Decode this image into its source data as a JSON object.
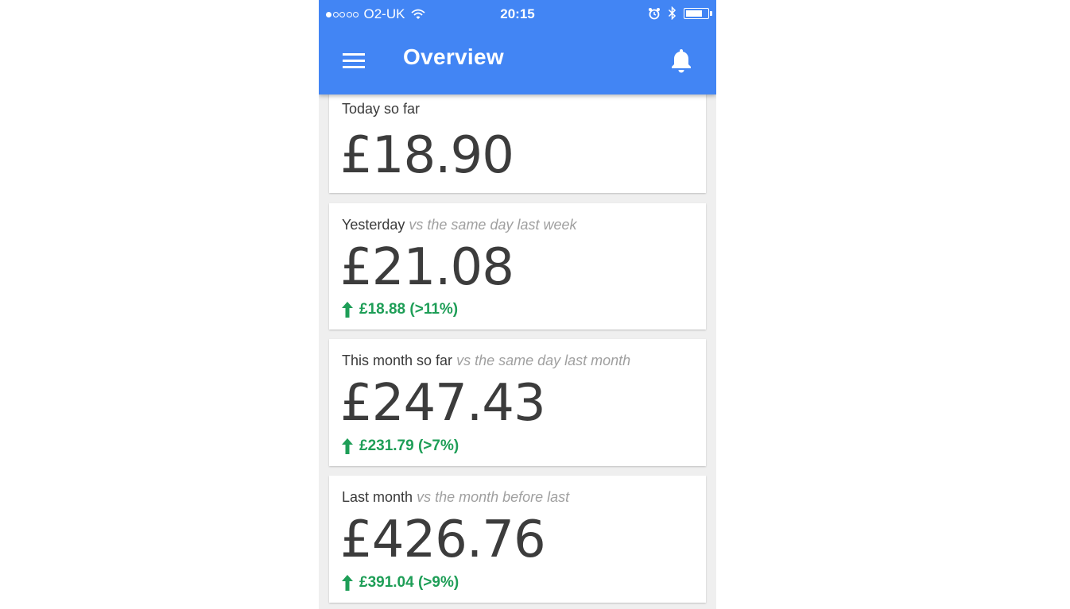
{
  "status_bar": {
    "carrier": "O2-UK",
    "time": "20:15",
    "signal_icon": "signal-dots-icon",
    "wifi_icon": "wifi-icon",
    "alarm_icon": "alarm-icon",
    "bluetooth_icon": "bluetooth-icon",
    "battery_icon": "battery-icon",
    "battery_level": 0.8
  },
  "app_bar": {
    "title": "Overview",
    "menu_icon": "hamburger-menu-icon",
    "notifications_icon": "bell-icon",
    "color": "#4285f4"
  },
  "cards": [
    {
      "label": "Today so far",
      "sub_label": "",
      "value": "£18.90",
      "change": ""
    },
    {
      "label": "Yesterday",
      "sub_label": "vs the same day last week",
      "value": "£21.08",
      "change": "£18.88 (>11%)",
      "change_icon": "arrow-up-icon"
    },
    {
      "label": "This month so far",
      "sub_label": "vs the same day last month",
      "value": "£247.43",
      "change": "£231.79 (>7%)",
      "change_icon": "arrow-up-icon"
    },
    {
      "label": "Last month",
      "sub_label": "vs the month before last",
      "value": "£426.76",
      "change": "£391.04 (>9%)",
      "change_icon": "arrow-up-icon"
    }
  ],
  "colors": {
    "positive": "#1e9e57",
    "background": "#efefef"
  }
}
